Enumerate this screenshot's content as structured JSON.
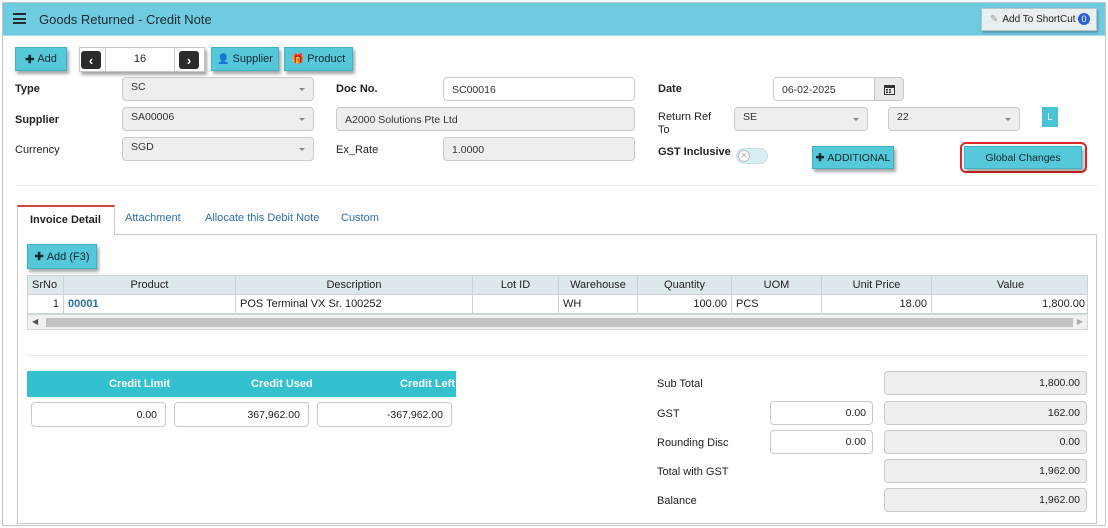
{
  "header": {
    "title": "Goods Returned - Credit Note",
    "shortcut_label": "Add To ShortCut",
    "shortcut_count": "0"
  },
  "toolbar": {
    "add_label": "Add",
    "record_number": "16",
    "supplier_label": "Supplier",
    "product_label": "Product"
  },
  "form": {
    "type_label": "Type",
    "type_value": "SC",
    "supplier_label": "Supplier",
    "supplier_value": "SA00006",
    "currency_label": "Currency",
    "currency_value": "SGD",
    "docno_label": "Doc No.",
    "docno_value": "SC00016",
    "supplier_name_value": "A2000 Solutions Pte Ltd",
    "exrate_label": "Ex_Rate",
    "exrate_value": "1.0000",
    "date_label": "Date",
    "date_value": "06-02-2025",
    "return_ref_label_1": "Return Ref",
    "return_ref_label_2": "To",
    "return_ref_type": "SE",
    "return_ref_no": "22",
    "l_badge": "L",
    "gst_inclusive_label": "GST Inclusive",
    "additional_label": "ADDITIONAL",
    "global_changes_label": "Global Changes"
  },
  "tabs": [
    {
      "label": "Invoice Detail"
    },
    {
      "label": "Attachment"
    },
    {
      "label": "Allocate this Debit Note"
    },
    {
      "label": "Custom"
    }
  ],
  "grid": {
    "add_label": "Add (F3)",
    "columns": [
      "SrNo",
      "Product",
      "Description",
      "Lot ID",
      "Warehouse",
      "Quantity",
      "UOM",
      "Unit Price",
      "Value"
    ],
    "rows": [
      {
        "srno": "1",
        "product": "00001",
        "description": "POS Terminal VX Sr. 100252",
        "lot_id": "",
        "warehouse": "WH",
        "quantity": "100.00",
        "uom": "PCS",
        "unit_price": "18.00",
        "value": "1,800.00"
      }
    ]
  },
  "credit": {
    "limit_label": "Credit Limit",
    "used_label": "Credit Used",
    "left_label": "Credit Left",
    "limit_value": "0.00",
    "used_value": "367,962.00",
    "left_value": "-367,962.00"
  },
  "totals": {
    "subtotal_label": "Sub Total",
    "subtotal_value": "1,800.00",
    "gst_label": "GST",
    "gst_rate": "0.00",
    "gst_value": "162.00",
    "rounding_label": "Rounding Disc",
    "rounding_input": "0.00",
    "rounding_value": "0.00",
    "total_label": "Total with GST",
    "total_value": "1,962.00",
    "balance_label": "Balance",
    "balance_value": "1,962.00"
  },
  "colors": {
    "header_bg": "#6fcbe0",
    "button_bg": "#55c8da",
    "credit_header_bg": "#33c1cf",
    "active_tab_accent": "#d2433d",
    "highlight_box": "#e0242a",
    "link": "#2d6fa3"
  }
}
